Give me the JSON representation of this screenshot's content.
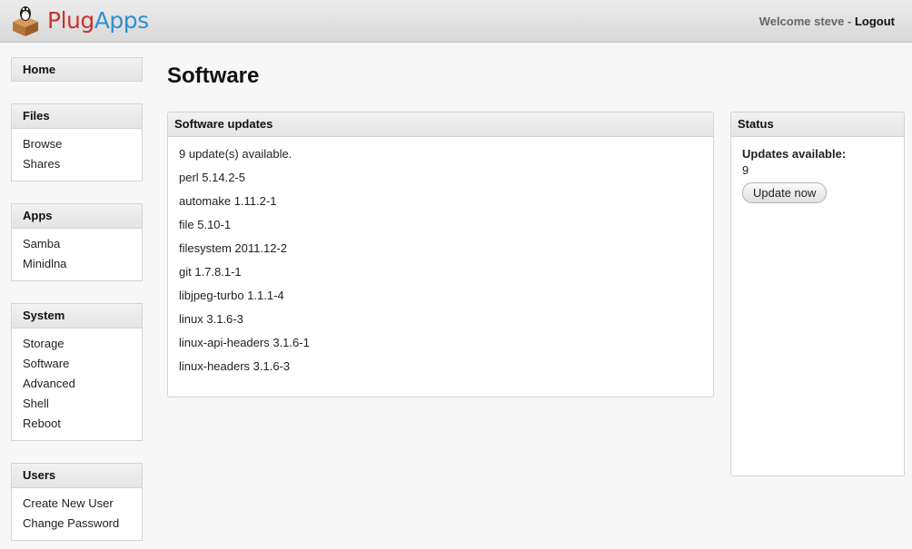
{
  "header": {
    "brand_part1": "Plug",
    "brand_part2": "Apps",
    "welcome": "Welcome steve",
    "separator": " - ",
    "logout": "Logout",
    "logo_icon": "tux-on-box-icon"
  },
  "sidebar": {
    "home": "Home",
    "sections": [
      {
        "title": "Files",
        "items": [
          "Browse",
          "Shares"
        ]
      },
      {
        "title": "Apps",
        "items": [
          "Samba",
          "Minidlna"
        ]
      },
      {
        "title": "System",
        "items": [
          "Storage",
          "Software",
          "Advanced",
          "Shell",
          "Reboot"
        ]
      },
      {
        "title": "Users",
        "items": [
          "Create New User",
          "Change Password"
        ]
      }
    ]
  },
  "main": {
    "title": "Software",
    "updates_panel": {
      "title": "Software updates",
      "summary": "9 update(s) available.",
      "packages": [
        "perl 5.14.2-5",
        "automake 1.11.2-1",
        "file 5.10-1",
        "filesystem 2011.12-2",
        "git 1.7.8.1-1",
        "libjpeg-turbo 1.1.1-4",
        "linux 3.1.6-3",
        "linux-api-headers 3.1.6-1",
        "linux-headers 3.1.6-3"
      ]
    },
    "status_panel": {
      "title": "Status",
      "label": "Updates available:",
      "value": "9",
      "button": "Update now"
    }
  },
  "colors": {
    "brand_red": "#c8342c",
    "brand_blue": "#2f8fd0"
  }
}
